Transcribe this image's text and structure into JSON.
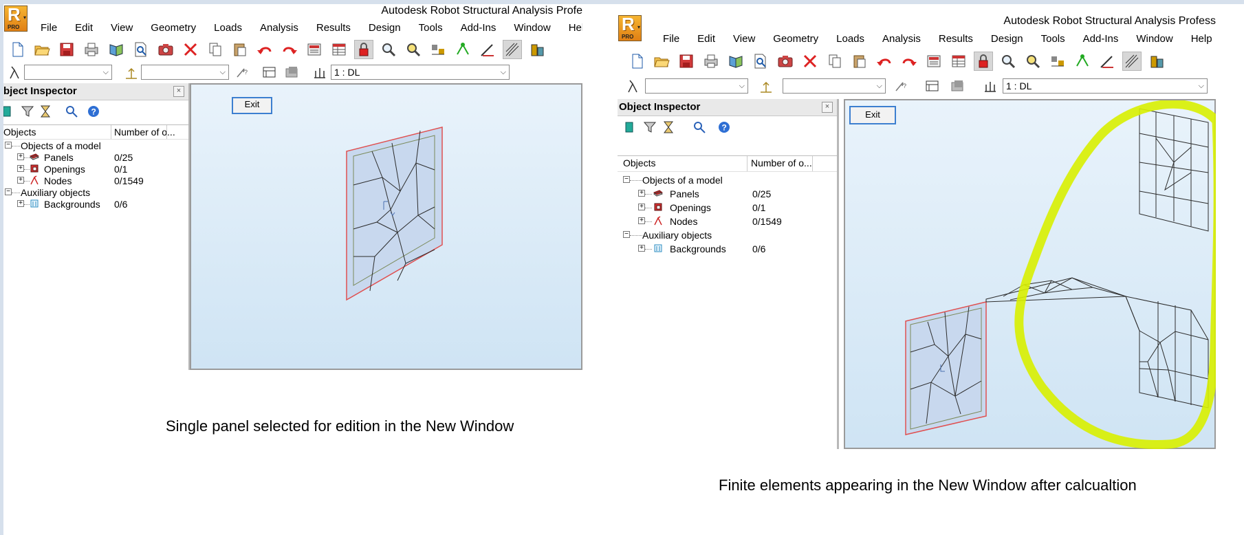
{
  "app": {
    "title": "Autodesk Robot Structural Analysis Profe",
    "title_full": "Autodesk Robot Structural Analysis Profess",
    "logo_letter": "R",
    "logo_badge": "PRO",
    "logo_dropdown": "▾"
  },
  "menu": [
    "File",
    "Edit",
    "View",
    "Geometry",
    "Loads",
    "Analysis",
    "Results",
    "Design",
    "Tools",
    "Add-Ins",
    "Window",
    "Help"
  ],
  "menu_short_last": "Help",
  "load_case": "1 : DL",
  "combo_arrow": "⌵",
  "close_glyph": "×",
  "inspector": {
    "title": "Object Inspector",
    "title_cropped": "bject Inspector",
    "col_objects": "Objects",
    "col_number": "Number of o...",
    "tree": [
      {
        "label": "Objects of a model",
        "level": 0,
        "value": "",
        "icon": "none",
        "toggle": "−"
      },
      {
        "label": "Panels",
        "level": 1,
        "value": "0/25",
        "icon": "panel-icon",
        "toggle": "+"
      },
      {
        "label": "Openings",
        "level": 1,
        "value": "0/1",
        "icon": "opening-icon",
        "toggle": "+"
      },
      {
        "label": "Nodes",
        "level": 1,
        "value": "0/1549",
        "icon": "node-icon",
        "toggle": "+"
      },
      {
        "label": "Auxiliary objects",
        "level": 0,
        "value": "",
        "icon": "none",
        "toggle": "−"
      },
      {
        "label": "Backgrounds",
        "level": 1,
        "value": "0/6",
        "icon": "background-icon",
        "toggle": "+"
      }
    ]
  },
  "exit_label": "Exit",
  "captions": {
    "left": "Single panel selected for edition in the New Window",
    "right": "Finite elements appearing in the New Window after calcualtion"
  },
  "colors": {
    "viewport_top": "#e9f3fb",
    "panel_outline": "#e05050",
    "mesh_line": "#2b2b2b",
    "highlight": "#d8f000",
    "logo": "#f0a024"
  }
}
